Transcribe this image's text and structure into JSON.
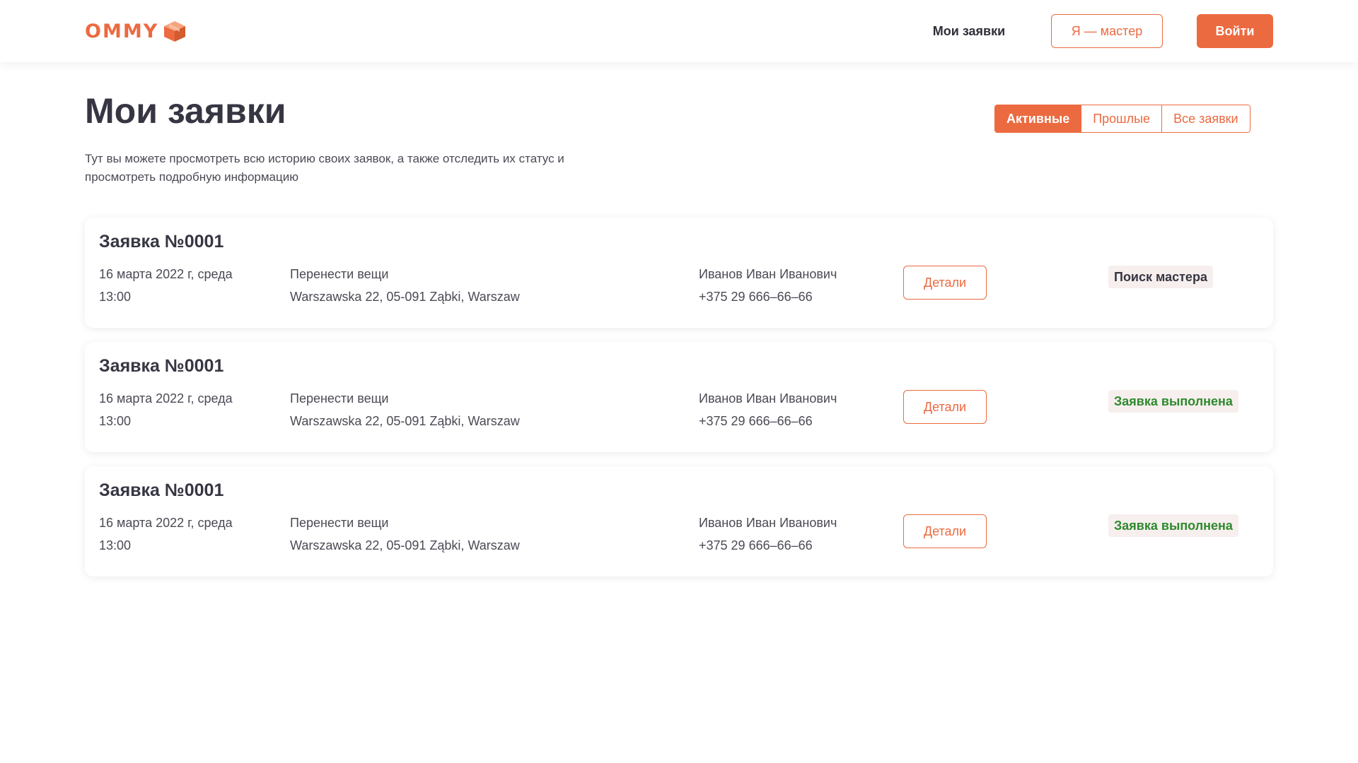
{
  "header": {
    "logo_text": "OMMY",
    "nav_my_requests": "Мои заявки",
    "master_button": "Я — мастер",
    "login_button": "Войти"
  },
  "page": {
    "title": "Мои заявки",
    "description": "Тут вы можете просмотреть всю историю своих заявок, а также отследить их статус и просмотреть подробную информацию"
  },
  "tabs": [
    {
      "label": "Активные",
      "active": true
    },
    {
      "label": "Прошлые",
      "active": false
    },
    {
      "label": "Все заявки",
      "active": false
    }
  ],
  "requests": [
    {
      "title": "Заявка №0001",
      "date": "16 марта 2022 г, среда",
      "time": "13:00",
      "task": "Перенести вещи",
      "address": "Warszawska 22, 05-091 Ząbki, Warszaw",
      "client_name": "Иванов Иван Иванович",
      "client_phone": "+375 29 666–66–66",
      "details_label": "Детали",
      "status": "Поиск мастера",
      "status_color": "#363643"
    },
    {
      "title": "Заявка №0001",
      "date": "16 марта 2022 г, среда",
      "time": "13:00",
      "task": "Перенести вещи",
      "address": "Warszawska 22, 05-091 Ząbki, Warszaw",
      "client_name": "Иванов Иван Иванович",
      "client_phone": "+375 29 666–66–66",
      "details_label": "Детали",
      "status": "Заявка выполнена",
      "status_color": "#2e8a2e"
    },
    {
      "title": "Заявка №0001",
      "date": "16 марта 2022 г, среда",
      "time": "13:00",
      "task": "Перенести вещи",
      "address": "Warszawska 22, 05-091 Ząbki, Warszaw",
      "client_name": "Иванов Иван Иванович",
      "client_phone": "+375 29 666–66–66",
      "details_label": "Детали",
      "status": "Заявка выполнена",
      "status_color": "#2e8a2e"
    }
  ],
  "colors": {
    "accent": "#ec6a40",
    "text_dark": "#363643",
    "status_done": "#2e8a2e"
  },
  "icons": {
    "logo": "orange-box-icon"
  }
}
